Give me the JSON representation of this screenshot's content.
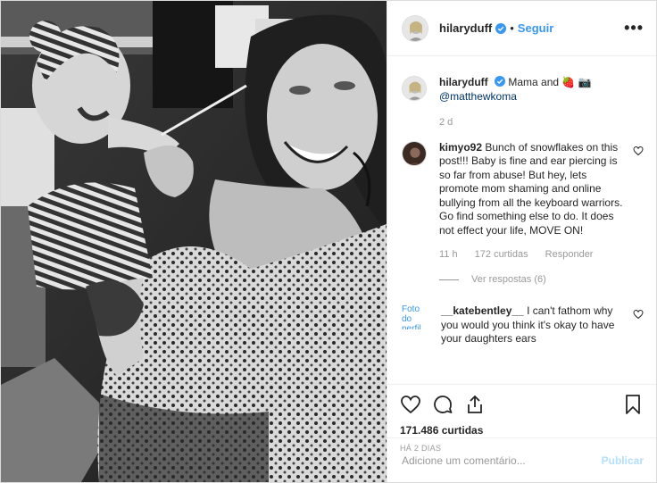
{
  "header": {
    "username": "hilaryduff",
    "separator": "•",
    "follow_label": "Seguir",
    "more_label": "•••"
  },
  "caption": {
    "username": "hilaryduff",
    "text": "Mama and",
    "emoji": "🍓 📷",
    "mention": "@matthewkoma",
    "age": "2 d"
  },
  "comments": [
    {
      "username": "kimyo92",
      "text": "Bunch of snowflakes on this post!!! Baby is fine and ear piercing is so far from abuse! But hey, lets promote mom shaming and online bullying from all the keyboard warriors. Go find something else to do. It does not effect your life, MOVE ON!",
      "age": "11 h",
      "likes": "172 curtidas",
      "reply": "Responder",
      "view_replies": "Ver respostas (6)"
    },
    {
      "username": "__katebentley__",
      "avatar_alt": "Foto do perfil",
      "text": "I can't fathom why you would you think it's okay to have your daughters ears"
    }
  ],
  "post": {
    "likes": "171.486 curtidas",
    "time": "HÁ 2 DIAS"
  },
  "comment_box": {
    "placeholder": "Adicione um comentário...",
    "publish_label": "Publicar"
  },
  "colors": {
    "link": "#3897f0",
    "publish_disabled": "#b2dffc",
    "muted": "#999999"
  }
}
